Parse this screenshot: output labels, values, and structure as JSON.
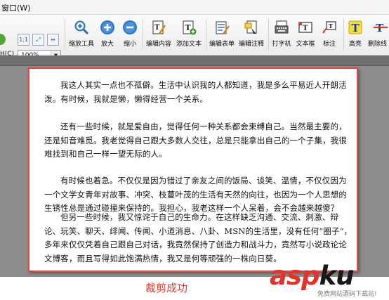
{
  "menu": {
    "window": "窗口(W)"
  },
  "left_partial_label": "H(C)",
  "zoom": {
    "value": "100%"
  },
  "toolbar": {
    "zoom_tool": "缩放工具",
    "zoom_in": "放大",
    "zoom_out": "缩小",
    "edit_content": "编辑内容",
    "add_text": "添加文本",
    "edit_form": "编辑表单",
    "edit_annotation": "编辑注释",
    "typewriter": "打字机",
    "textbox": "文本框",
    "callout": "标注",
    "highlight": "高亮",
    "strikethrough": "删除线"
  },
  "document": {
    "paragraphs": [
      "我这人其实一点也不孤僻。生活中认识我的人都知道，我是多么平易近人开朗活泼。有时候，我就是懒，懒得经营一个关系。",
      "还有一些时候，就是爱自由，觉得任何一种关系都会束缚自己。当然最主要的，还是知音难觅。我老觉得自己跟大多数人交往，总是只能拿出自己的一个子集，我很难找到和自己一样一望无际的人。",
      "有时候也着急。不仅仅是因为错过了亲友之间的饭局、谈笑、温情，不仅仅因为一个文学女青年对故事、冲突、枝蔓叶茂的生活有天然的向往，也因为一个人思想的生锈性总是通过碰撞来保持的。我担心，我老这样一个人呆着，会不会越来越傻？",
      "但另一些时候，我又惊诧于自己的生命力。在这样缺乏沟通、交流、刺激、辩论、玩笑、聊天、绯闻、传闻、小道消息、八卦、MSN的生活里，没有任何“圈子”，多年来仅仅凭着自己跟自己对话，我竟然保持了创造力和战斗力，竟然写小说政论论文博客，而且写得如此饱满热情，我又是何等顽强的一株向日葵。"
    ]
  },
  "caption": "裁剪成功",
  "watermark": {
    "asp": "asp",
    "ku": "ku",
    "dot": ".",
    "tld": "com",
    "subtitle": "免费网站源码下载站!"
  }
}
